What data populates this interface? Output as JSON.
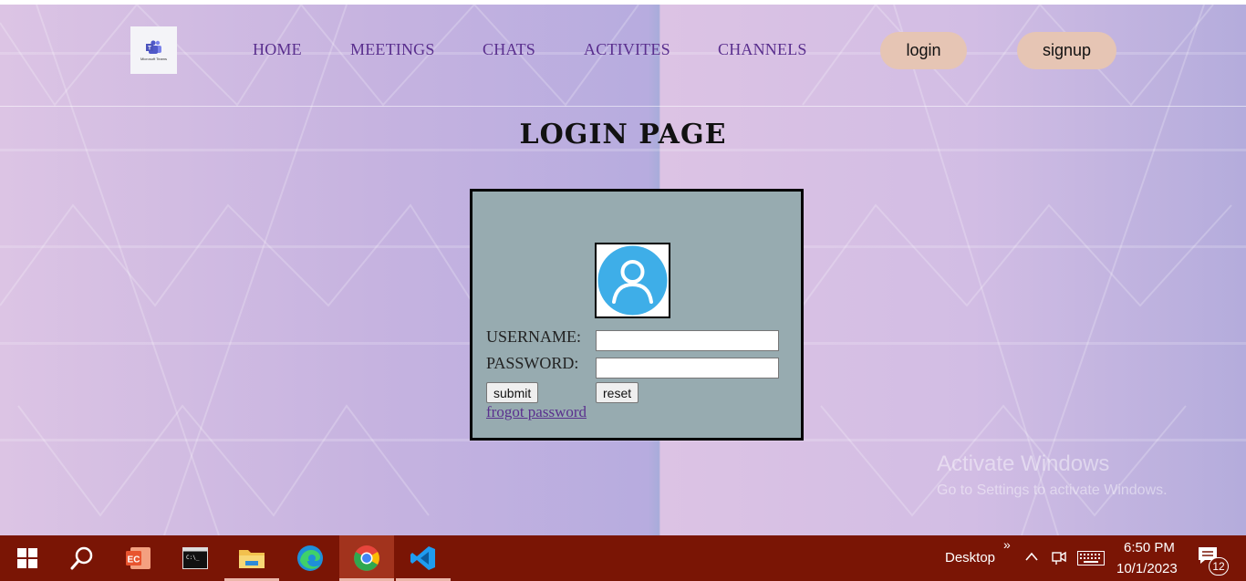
{
  "nav": {
    "logo_text": "Microsoft Teams",
    "links": [
      "HOME",
      "MEETINGS",
      "CHATS",
      "ACTIVITES",
      "CHANNELS"
    ],
    "login_label": "login",
    "signup_label": "signup"
  },
  "main": {
    "title": "LOGIN PAGE",
    "form": {
      "username_label": "USERNAME:",
      "password_label": "PASSWORD:",
      "username_value": "",
      "password_value": "",
      "submit_label": "submit",
      "reset_label": "reset",
      "forgot_label": "frogot password"
    }
  },
  "watermark": {
    "title": "Activate Windows",
    "subtitle": "Go to Settings to activate Windows."
  },
  "taskbar": {
    "apps": [
      "windows-start-icon",
      "search-icon",
      "powerpoint-icon",
      "terminal-icon",
      "file-explorer-icon",
      "edge-icon",
      "chrome-icon",
      "vscode-icon"
    ],
    "desktop_label": "Desktop",
    "overflow_glyph": "»",
    "time": "6:50 PM",
    "date": "10/1/2023",
    "notification_count": "12"
  },
  "colors": {
    "nav_link": "#5a2f8e",
    "pill": "#e6c5b4",
    "login_box": "#97abb0",
    "taskbar": "#7a1505",
    "avatar_blue": "#3eaee8"
  }
}
